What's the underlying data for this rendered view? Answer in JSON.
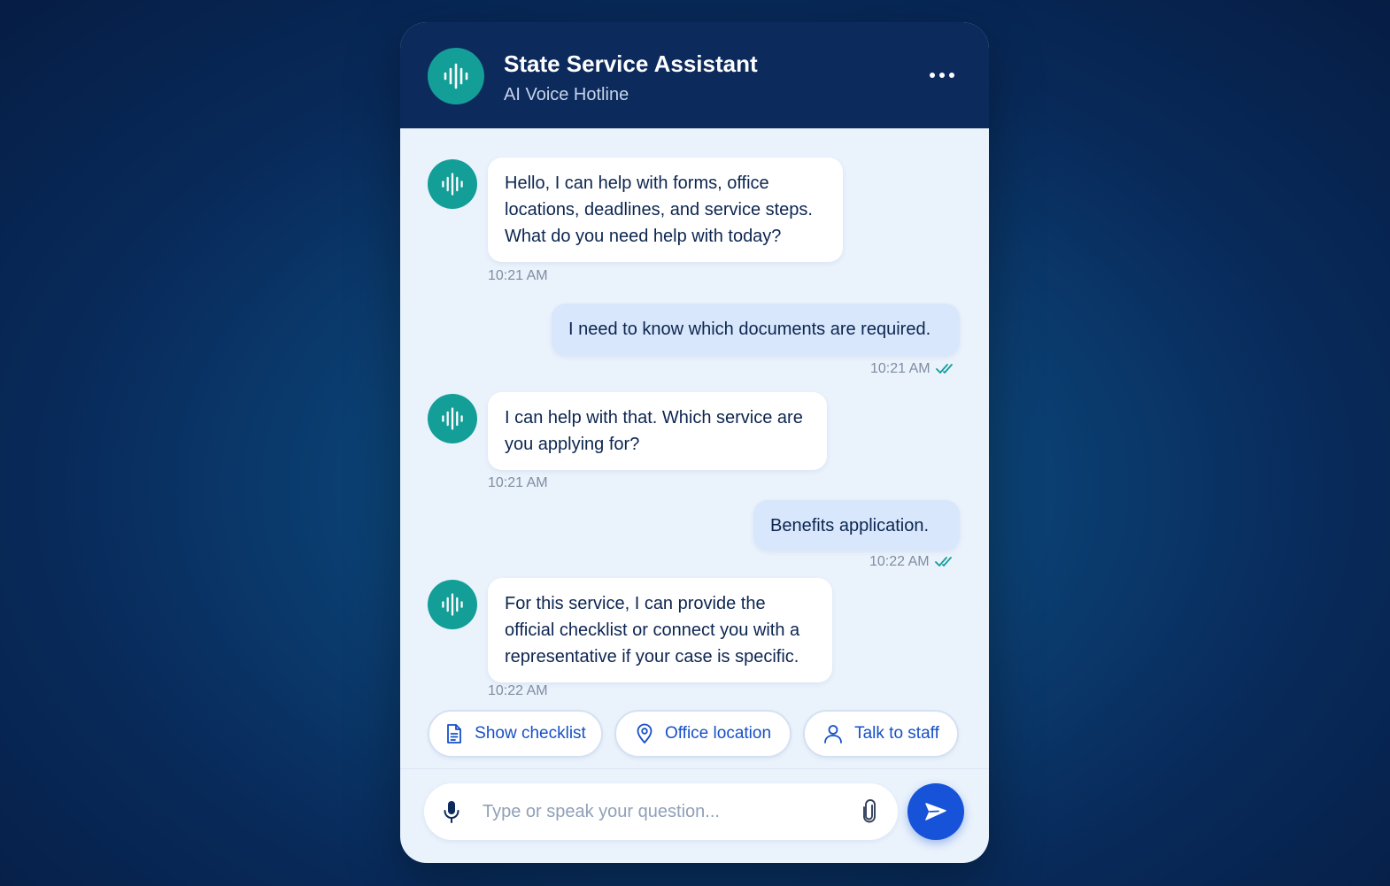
{
  "header": {
    "title": "State Service Assistant",
    "subtitle": "AI Voice Hotline",
    "avatar_icon": "voice-wave-icon",
    "menu_icon": "more-horizontal-icon"
  },
  "messages": [
    {
      "from": "assistant",
      "text": "Hello, I can help with forms, office locations, deadlines, and service steps. What do you need help with today?",
      "time": "10:21 AM"
    },
    {
      "from": "user",
      "text": "I need to know which documents are required.",
      "time": "10:21 AM",
      "status_icon": "double-check-icon"
    },
    {
      "from": "assistant",
      "text": "I can help with that. Which service are you applying for?",
      "time": "10:21 AM"
    },
    {
      "from": "user",
      "text": "Benefits application.",
      "time": "10:22 AM",
      "status_icon": "double-check-icon"
    },
    {
      "from": "assistant",
      "text": "For this service, I can provide the official checklist or connect you with a representative if your case is specific.",
      "time": "10:22 AM"
    }
  ],
  "quick_replies": [
    {
      "label": "Show checklist",
      "icon": "document-icon"
    },
    {
      "label": "Office location",
      "icon": "location-pin-icon"
    },
    {
      "label": "Talk to staff",
      "icon": "person-icon"
    }
  ],
  "composer": {
    "placeholder": "Type or speak your question...",
    "mic_icon": "microphone-icon",
    "attach_icon": "paperclip-icon",
    "send_icon": "send-icon"
  },
  "colors": {
    "header_bg": "#0c2a5c",
    "avatar_teal": "#139e98",
    "panel_bg": "#eaf2fc",
    "user_bubble": "#d8e7fb",
    "accent_blue": "#1653d8",
    "check_teal": "#139e98"
  }
}
